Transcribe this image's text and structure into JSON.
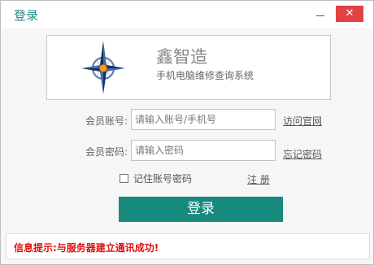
{
  "window": {
    "title": "登录",
    "close_glyph": "✕"
  },
  "banner": {
    "app_name": "鑫智造",
    "app_subtitle": "手机电脑维修查询系统",
    "logo_icon": "compass-rose-icon"
  },
  "form": {
    "account_label": "会员账号:",
    "account_placeholder": "请输入账号/手机号",
    "account_value": "",
    "password_label": "会员密码:",
    "password_placeholder": "请输入密码",
    "password_value": "",
    "visit_site_link": "访问官网",
    "forgot_password_link": "忘记密码",
    "remember_label": "记住账号密码",
    "remember_checked": false,
    "register_link": "注 册",
    "login_button": "登录"
  },
  "status": {
    "message": "信息提示:与服务器建立通讯成功!"
  },
  "colors": {
    "accent": "#17897d",
    "title": "#1f8a82",
    "close": "#e04343",
    "status_text": "#e01010"
  }
}
